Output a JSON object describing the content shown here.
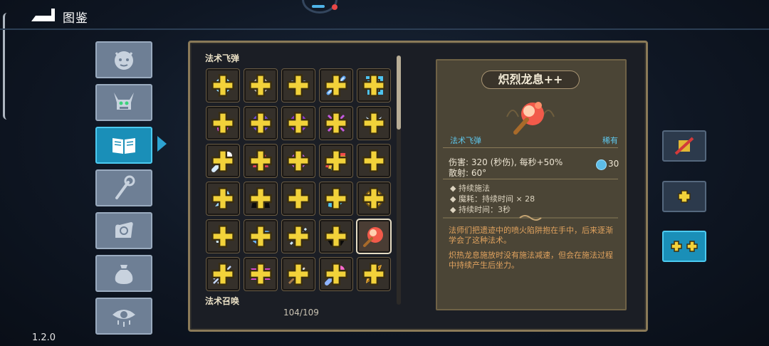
{
  "header": {
    "title": "图鉴"
  },
  "version": "1.2.0",
  "side_tabs": [
    {
      "name": "monster-tab",
      "icon": "demon-face-icon",
      "active": false
    },
    {
      "name": "boss-tab",
      "icon": "horned-demon-icon",
      "active": false
    },
    {
      "name": "spellbook-tab",
      "icon": "open-book-icon",
      "active": true
    },
    {
      "name": "staff-tab",
      "icon": "magic-staff-icon",
      "active": false
    },
    {
      "name": "relic-tab",
      "icon": "hand-rune-icon",
      "active": false
    },
    {
      "name": "item-tab",
      "icon": "pouch-icon",
      "active": false
    },
    {
      "name": "curse-tab",
      "icon": "dripping-eye-icon",
      "active": false
    }
  ],
  "grid": {
    "section_top": "法术飞弹",
    "section_bottom": "法术召唤",
    "counter": "104/109",
    "rows": [
      [
        {
          "icon": "ice-orb-icon"
        },
        {
          "icon": "stone-orb-icon"
        },
        {
          "icon": "butterfly-icon"
        },
        {
          "icon": "magic-bolt-icon"
        },
        {
          "icon": "spiral-square-icon"
        }
      ],
      [
        {
          "icon": "pink-flame-icon"
        },
        {
          "icon": "purple-vortex-icon"
        },
        {
          "icon": "violet-orb-icon"
        },
        {
          "icon": "crossed-arrows-icon"
        },
        {
          "icon": "frost-wolf-icon"
        }
      ],
      [
        {
          "icon": "comet-icon"
        },
        {
          "icon": "crimson-beast-icon"
        },
        {
          "icon": "crystal-cluster-icon"
        },
        {
          "icon": "rainbow-icon"
        },
        {
          "icon": "star-sparkle-icon"
        }
      ],
      [
        {
          "icon": "ice-shard-icon"
        },
        {
          "icon": "shadow-creature-icon"
        },
        {
          "icon": "lightning-icon"
        },
        {
          "icon": "water-wave-icon"
        },
        {
          "icon": "gold-coin-icon"
        }
      ],
      [
        {
          "icon": "crescent-blade-icon"
        },
        {
          "icon": "blue-slash-icon"
        },
        {
          "icon": "chain-icon"
        },
        {
          "icon": "dark-blob-icon"
        },
        {
          "icon": "fire-breath-icon",
          "selected": true
        }
      ],
      [
        {
          "icon": "triple-spear-icon"
        },
        {
          "icon": "hexagram-icon"
        },
        {
          "icon": "arrow-icon"
        },
        {
          "icon": "meteor-icon"
        },
        {
          "icon": "golden-feather-icon"
        }
      ]
    ]
  },
  "detail": {
    "name": "炽烈龙息++",
    "type": "法术飞弹",
    "rarity": "稀有",
    "damage": "伤害: 320 (秒伤), 每秒+50%",
    "spread": "散射: 60°",
    "mana_cost": "30",
    "bullets": [
      "持续施法",
      "魔耗：持续时间 × 28",
      "持续时间：3秒"
    ],
    "desc1": "法师们把遗迹中的喷火陷阱抱在手中，后来逐渐学会了这种法术。",
    "desc2": "炽热龙息施放时没有施法减速，但会在施法过程中持续产生后坐力。"
  },
  "right_buttons": [
    {
      "name": "base-variant-button",
      "icon": "crossed-out-icon",
      "active": false
    },
    {
      "name": "plus-variant-button",
      "icon": "single-plus-icon",
      "active": false
    },
    {
      "name": "plusplus-variant-button",
      "icon": "double-plus-icon",
      "active": true
    }
  ],
  "colors": {
    "accent_blue": "#1a8fb8",
    "frame_gold": "#8a7a58",
    "desc_orange": "#e0a25e",
    "label_cyan": "#5ec8ee"
  }
}
